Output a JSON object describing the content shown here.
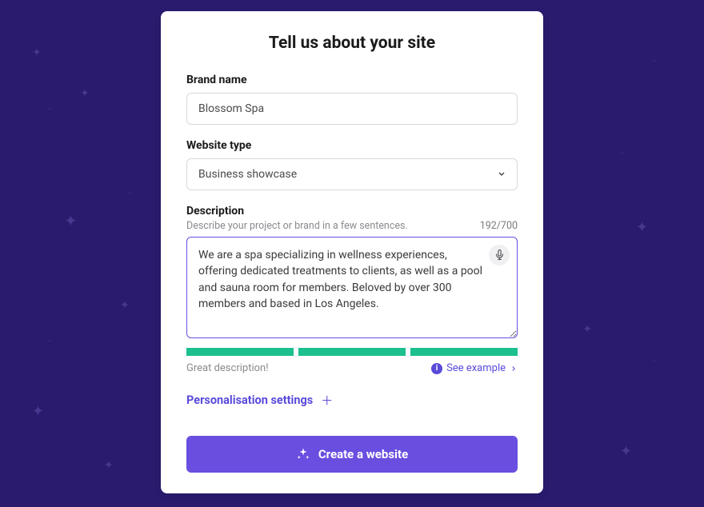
{
  "title": "Tell us about your site",
  "brand": {
    "label": "Brand name",
    "value": "Blossom Spa"
  },
  "website_type": {
    "label": "Website type",
    "value": "Business showcase"
  },
  "description": {
    "label": "Description",
    "hint": "Describe your project or brand in a few sentences.",
    "char_count": "192/700",
    "value": "We are a spa specializing in wellness experiences, offering dedicated treatments to clients, as well as a pool and sauna room for members. Beloved by over 300 members and based in Los Angeles.",
    "feedback": "Great description!",
    "see_example": "See example"
  },
  "personalisation": {
    "label": "Personalisation settings"
  },
  "cta": {
    "label": "Create a website"
  },
  "colors": {
    "primary": "#6a4ee0",
    "success": "#1dbf8f",
    "bg": "#2a1b6e"
  }
}
